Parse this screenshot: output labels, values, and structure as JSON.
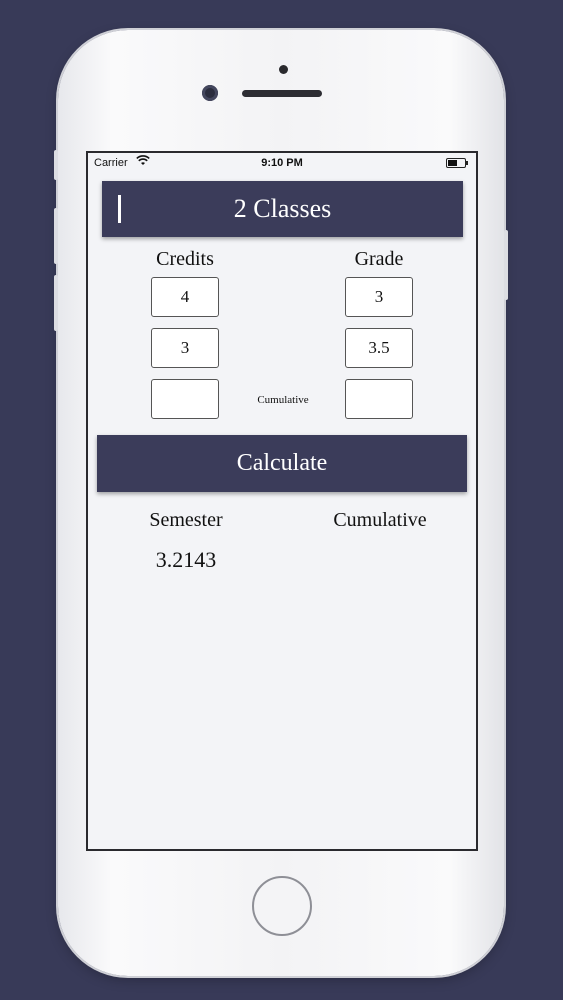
{
  "status_bar": {
    "carrier": "Carrier",
    "time": "9:10 PM"
  },
  "header": {
    "title": "2 Classes"
  },
  "columns": {
    "credits_label": "Credits",
    "grade_label": "Grade",
    "cumulative_small_label": "Cumulative"
  },
  "rows": [
    {
      "credits": "4",
      "grade": "3"
    },
    {
      "credits": "3",
      "grade": "3.5"
    },
    {
      "credits": "",
      "grade": ""
    }
  ],
  "actions": {
    "calculate_label": "Calculate"
  },
  "results": {
    "semester_label": "Semester",
    "cumulative_label": "Cumulative",
    "semester_value": "3.2143",
    "cumulative_value": ""
  },
  "colors": {
    "background": "#383a58",
    "accent": "#3b3c5a",
    "screen": "#f3f4f7"
  },
  "icons": {
    "wifi": "wifi-icon",
    "battery": "battery-icon"
  }
}
